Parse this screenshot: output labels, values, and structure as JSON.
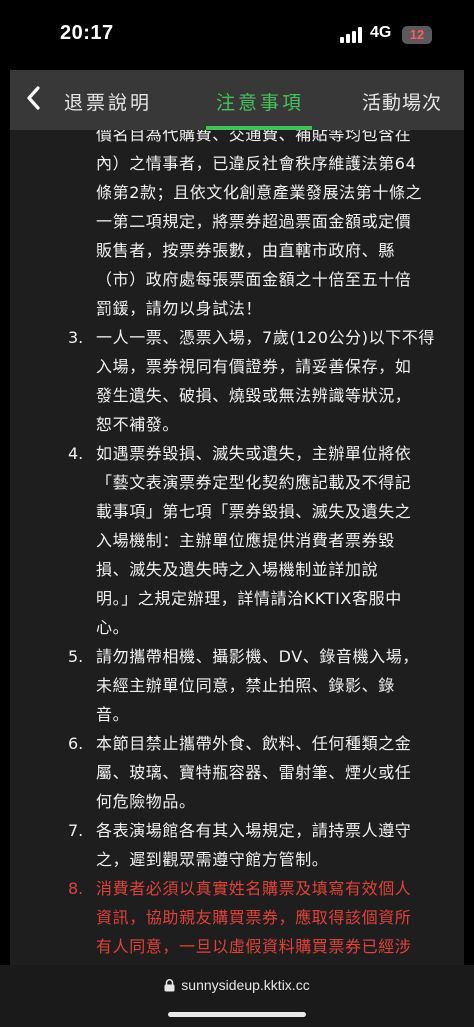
{
  "status_bar": {
    "time": "20:17",
    "network": "4G",
    "battery": "12"
  },
  "tabs": {
    "left": "退票說明",
    "center": "注意事項",
    "right": "活動場次"
  },
  "content": {
    "intro_lines": [
      "價名目為代購費、交通費、補貼等均包含在",
      "內）之情事者，已違反社會秩序維護法第64",
      "條第2款；且依文化創意產業發展法第十條之",
      "一第二項規定，將票券超過票面金額或定價",
      "販售者，按票券張數，由直轄市政府、縣",
      "（市）政府處每張票面金額之十倍至五十倍",
      "罰鍰，請勿以身試法！"
    ],
    "items": [
      {
        "num": "3.",
        "lines": [
          "一人一票、憑票入場，7歲(120公分)以下不得",
          "入場，票券視同有價證券，請妥善保存，如",
          "發生遺失、破損、燒毀或無法辨識等狀況，",
          "恕不補發。"
        ]
      },
      {
        "num": "4.",
        "lines": [
          "如遇票券毀損、滅失或遺失，主辦單位將依",
          "「藝文表演票券定型化契約應記載及不得記",
          "載事項」第七項「票券毀損、滅失及遺失之",
          "入場機制：主辦單位應提供消費者票券毀",
          "損、滅失及遺失時之入場機制並詳加說",
          "明。」之規定辦理，詳情請洽KKTIX客服中",
          "心。"
        ]
      },
      {
        "num": "5.",
        "lines": [
          "請勿攜帶相機、攝影機、DV、錄音機入場，",
          "未經主辦單位同意，禁止拍照、錄影、錄",
          "音。"
        ]
      },
      {
        "num": "6.",
        "lines": [
          "本節目禁止攜帶外食、飲料、任何種類之金",
          "屬、玻璃、寶特瓶容器、雷射筆、煙火或任",
          "何危險物品。"
        ]
      },
      {
        "num": "7.",
        "lines": [
          "各表演場館各有其入場規定，請持票人遵守",
          "之，遲到觀眾需遵守館方管制。"
        ]
      },
      {
        "num": "8.",
        "lines": [
          "消費者必須以真實姓名購票及填寫有效個人",
          "資訊，協助親友購買票券，應取得該個資所",
          "有人同意，一旦以虛假資料購買票券已經涉"
        ]
      }
    ]
  },
  "browser": {
    "url": "sunnysideup.kktix.cc"
  },
  "colors": {
    "accent": "#44c25a",
    "warning": "#e0413a",
    "battery_low": "#ff5b57"
  }
}
